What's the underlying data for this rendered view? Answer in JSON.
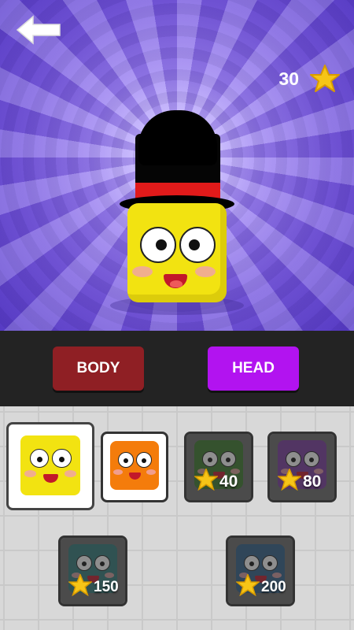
{
  "hud": {
    "coin_count": "30",
    "back_icon": "arrow-left-icon",
    "currency_icon": "star-icon",
    "currency_color": "#f6c517"
  },
  "tabs": [
    {
      "label": "BODY",
      "color": "#8f1f24",
      "active": false
    },
    {
      "label": "HEAD",
      "color": "#b213f0",
      "active": true
    }
  ],
  "character": {
    "head_color": "#f2e311",
    "hat": "top-hat",
    "hat_band_color": "#e11a1a"
  },
  "skins": [
    {
      "name": "yellow",
      "color": "#f2e311",
      "state": "selected",
      "price": ""
    },
    {
      "name": "orange",
      "color": "#f47c0b",
      "state": "owned",
      "price": ""
    },
    {
      "name": "green",
      "color": "#3a7a2c",
      "state": "locked",
      "price": "40"
    },
    {
      "name": "purple",
      "color": "#7a3aa0",
      "state": "locked",
      "price": "80"
    },
    {
      "name": "teal",
      "color": "#2f7a7a",
      "state": "locked",
      "price": "150"
    },
    {
      "name": "blue",
      "color": "#2f5f8a",
      "state": "locked",
      "price": "200"
    }
  ]
}
